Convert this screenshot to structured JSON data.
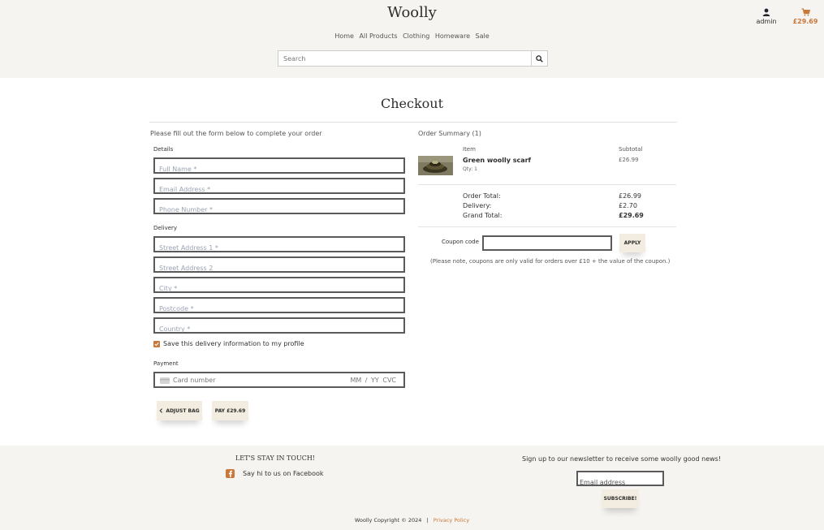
{
  "header": {
    "brand": "Woolly",
    "nav": [
      "Home",
      "All Products",
      "Clothing",
      "Homeware",
      "Sale"
    ],
    "search_placeholder": "Search",
    "account_label": "admin",
    "bag_total": "£29.69"
  },
  "checkout": {
    "title": "Checkout",
    "intro": "Please fill out the form below to complete your order",
    "details_label": "Details",
    "full_name_placeholder": "Full Name *",
    "email_placeholder": "Email Address *",
    "phone_placeholder": "Phone Number *",
    "delivery_label": "Delivery",
    "street1_placeholder": "Street Address 1 *",
    "street2_placeholder": "Street Address 2",
    "city_placeholder": "City *",
    "postcode_placeholder": "Postcode *",
    "country_placeholder": "Country *",
    "save_info_label": "Save this delivery information to my profile",
    "payment_label": "Payment",
    "card_placeholder": "Card number",
    "card_exp_cvc": "MM / YY  CVC",
    "adjust_bag_label": "ADJUST BAG",
    "pay_label": "PAY £29.69"
  },
  "summary": {
    "title": "Order Summary (1)",
    "col_item": "Item",
    "col_subtotal": "Subtotal",
    "item_name": "Green woolly scarf",
    "item_qty": "Qty: 1",
    "item_subtotal": "£26.99",
    "order_total_label": "Order Total:",
    "order_total_value": "£26.99",
    "delivery_label": "Delivery:",
    "delivery_value": "£2.70",
    "grand_total_label": "Grand Total:",
    "grand_total_value": "£29.69",
    "coupon_label": "Coupon code",
    "apply_label": "APPLY",
    "coupon_note": "(Please note, coupons are only valid for orders over £10 + the value of the coupon.)"
  },
  "footer": {
    "stay_title": "LET'S STAY IN TOUCH!",
    "facebook_text": "Say hi to us on Facebook",
    "newsletter_text": "Sign up to our newsletter to receive some woolly good news!",
    "newsletter_placeholder": "Email address",
    "subscribe_label": "SUBSCRIBE!",
    "copyright": "Woolly Copyright © 2024",
    "separator": "|",
    "privacy_label": "Privacy Policy"
  },
  "colors": {
    "accent": "#c9783a",
    "header_bg": "#f5f4f0",
    "button_bg": "#f2ede0"
  }
}
